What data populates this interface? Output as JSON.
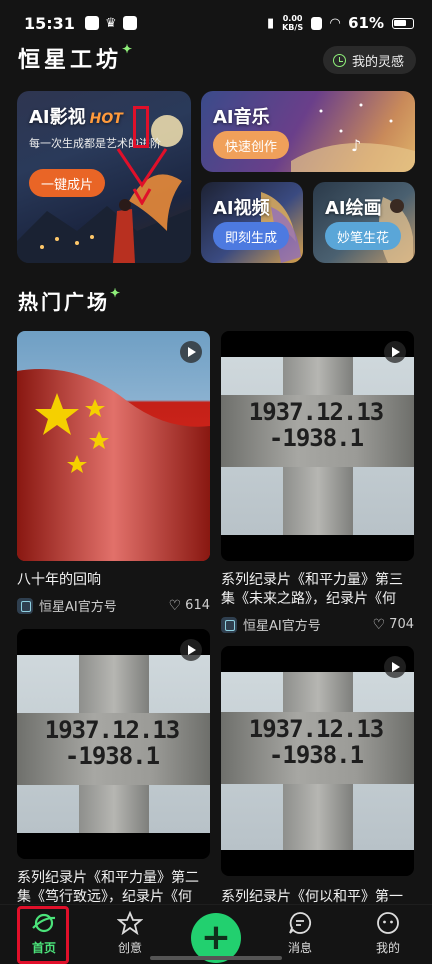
{
  "status_bar": {
    "time": "15:31",
    "net_speed_value": "0.00",
    "net_speed_unit": "KB/S",
    "battery": "61%"
  },
  "header": {
    "title": "恒星工坊",
    "inspiration_button": "我的灵感"
  },
  "features": {
    "video": {
      "title": "AI影视",
      "badge": "HOT",
      "subtitle": "每一次生成都是艺术的进阶",
      "button": "一键成片"
    },
    "music": {
      "title": "AI音乐",
      "button": "快速创作"
    },
    "ai_video": {
      "title": "AI视频",
      "button": "即刻生成"
    },
    "drawing": {
      "title": "AI绘画",
      "button": "妙笔生花"
    }
  },
  "section": {
    "title": "热门广场"
  },
  "engraving": {
    "line1": "1937.12.13",
    "line2": "-1938.1"
  },
  "feed": [
    {
      "title": "八十年的回响",
      "author": "恒星AI官方号",
      "likes": "614"
    },
    {
      "title": "系列纪录片《和平力量》第三集《未来之路》，纪录片《何",
      "author": "恒星AI官方号",
      "likes": "704"
    },
    {
      "title": "系列纪录片《和平力量》第二集《笃行致远》，纪录片《何",
      "author": "",
      "likes": ""
    },
    {
      "title": "系列纪录片《何以和平》第一",
      "author": "",
      "likes": ""
    }
  ],
  "nav": {
    "home": "首页",
    "create": "创意",
    "messages": "消息",
    "mine": "我的"
  },
  "colors": {
    "accent_green": "#22d06f",
    "highlight_red": "#e0102a",
    "hot_orange": "#e96526"
  }
}
